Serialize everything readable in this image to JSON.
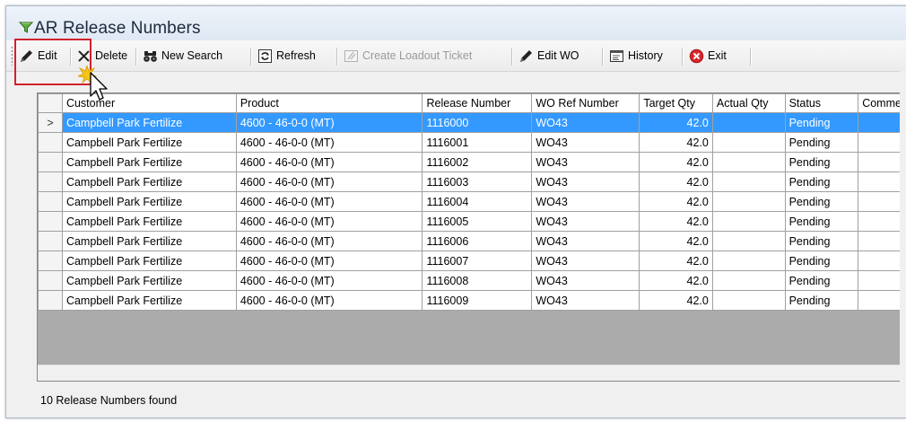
{
  "window": {
    "title": "AR Release Numbers",
    "icon": "funnel-icon"
  },
  "toolbar": {
    "edit_label": "Edit",
    "delete_label": "Delete",
    "new_search_label": "New Search",
    "refresh_label": "Refresh",
    "create_loadout_label": "Create Loadout Ticket",
    "edit_wo_label": "Edit WO",
    "history_label": "History",
    "exit_label": "Exit"
  },
  "grid": {
    "columns": [
      "Customer",
      "Product",
      "Release Number",
      "WO Ref Number",
      "Target Qty",
      "Actual Qty",
      "Status",
      "Comme"
    ],
    "selected_marker": ">",
    "rows": [
      {
        "customer": "Campbell Park Fertilize",
        "product": "4600 - 46-0-0 (MT)",
        "release": "1116000",
        "wo": "WO43",
        "target": "42.0",
        "actual": "",
        "status": "Pending",
        "comment": ""
      },
      {
        "customer": "Campbell Park Fertilize",
        "product": "4600 - 46-0-0 (MT)",
        "release": "1116001",
        "wo": "WO43",
        "target": "42.0",
        "actual": "",
        "status": "Pending",
        "comment": ""
      },
      {
        "customer": "Campbell Park Fertilize",
        "product": "4600 - 46-0-0 (MT)",
        "release": "1116002",
        "wo": "WO43",
        "target": "42.0",
        "actual": "",
        "status": "Pending",
        "comment": ""
      },
      {
        "customer": "Campbell Park Fertilize",
        "product": "4600 - 46-0-0 (MT)",
        "release": "1116003",
        "wo": "WO43",
        "target": "42.0",
        "actual": "",
        "status": "Pending",
        "comment": ""
      },
      {
        "customer": "Campbell Park Fertilize",
        "product": "4600 - 46-0-0 (MT)",
        "release": "1116004",
        "wo": "WO43",
        "target": "42.0",
        "actual": "",
        "status": "Pending",
        "comment": ""
      },
      {
        "customer": "Campbell Park Fertilize",
        "product": "4600 - 46-0-0 (MT)",
        "release": "1116005",
        "wo": "WO43",
        "target": "42.0",
        "actual": "",
        "status": "Pending",
        "comment": ""
      },
      {
        "customer": "Campbell Park Fertilize",
        "product": "4600 - 46-0-0 (MT)",
        "release": "1116006",
        "wo": "WO43",
        "target": "42.0",
        "actual": "",
        "status": "Pending",
        "comment": ""
      },
      {
        "customer": "Campbell Park Fertilize",
        "product": "4600 - 46-0-0 (MT)",
        "release": "1116007",
        "wo": "WO43",
        "target": "42.0",
        "actual": "",
        "status": "Pending",
        "comment": ""
      },
      {
        "customer": "Campbell Park Fertilize",
        "product": "4600 - 46-0-0 (MT)",
        "release": "1116008",
        "wo": "WO43",
        "target": "42.0",
        "actual": "",
        "status": "Pending",
        "comment": ""
      },
      {
        "customer": "Campbell Park Fertilize",
        "product": "4600 - 46-0-0 (MT)",
        "release": "1116009",
        "wo": "WO43",
        "target": "42.0",
        "actual": "",
        "status": "Pending",
        "comment": ""
      }
    ]
  },
  "status_bar": {
    "text": "10 Release Numbers found"
  },
  "colors": {
    "selection": "#3399ff",
    "highlight_box": "#d0222b",
    "exit_icon": "#d9262b"
  }
}
